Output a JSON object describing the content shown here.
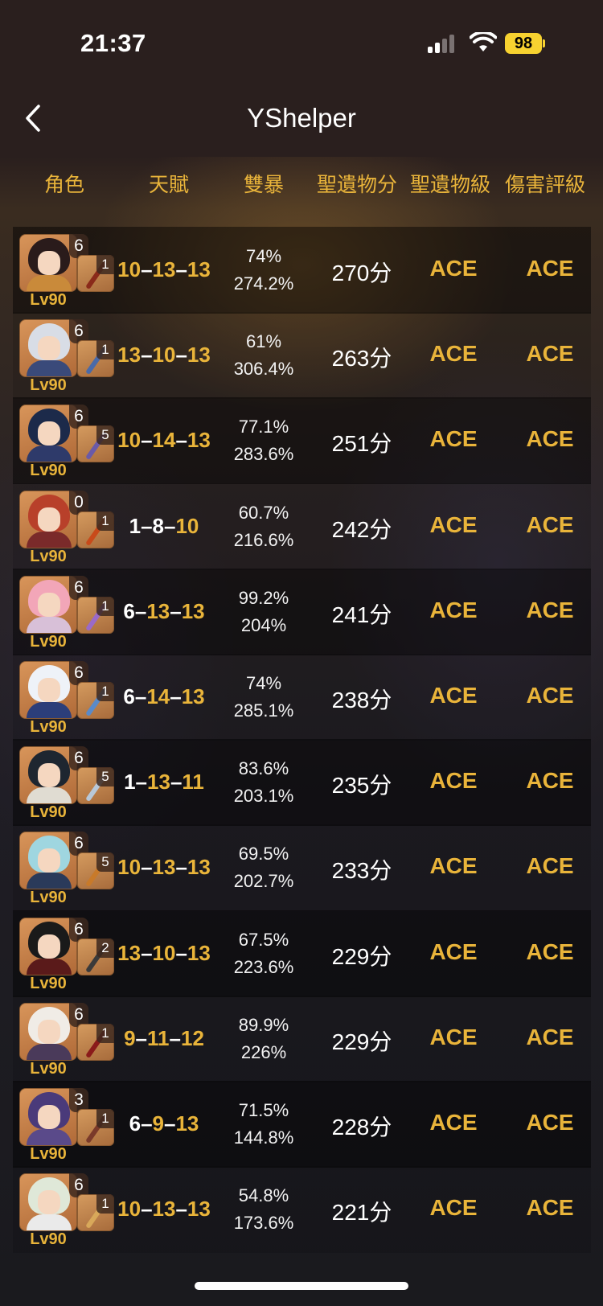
{
  "status_bar": {
    "time": "21:37",
    "battery": "98"
  },
  "nav": {
    "title": "YShelper"
  },
  "header": {
    "character": "角色",
    "talent": "天賦",
    "crit": "雙暴",
    "artifact_score": "聖遺物分",
    "artifact_grade": "聖遺物級",
    "damage_grade": "傷害評級"
  },
  "colors": {
    "accent": "#e9b43a",
    "text": "#ffffff",
    "header_bg": "#2a1f1e"
  },
  "rows": [
    {
      "constellation": "6",
      "refinement": "1",
      "level": "Lv90",
      "talent_1": "10",
      "talent_2": "13",
      "talent_3": "13",
      "crit_rate": "74%",
      "crit_dmg": "274.2%",
      "score": "270分",
      "artifact_grade": "ACE",
      "damage_grade": "ACE"
    },
    {
      "constellation": "6",
      "refinement": "1",
      "level": "Lv90",
      "talent_1": "13",
      "talent_2": "10",
      "talent_3": "13",
      "crit_rate": "61%",
      "crit_dmg": "306.4%",
      "score": "263分",
      "artifact_grade": "ACE",
      "damage_grade": "ACE"
    },
    {
      "constellation": "6",
      "refinement": "5",
      "level": "Lv90",
      "talent_1": "10",
      "talent_2": "14",
      "talent_3": "13",
      "crit_rate": "77.1%",
      "crit_dmg": "283.6%",
      "score": "251分",
      "artifact_grade": "ACE",
      "damage_grade": "ACE"
    },
    {
      "constellation": "0",
      "refinement": "1",
      "level": "Lv90",
      "talent_1": "1",
      "talent_2": "8",
      "talent_3": "10",
      "crit_rate": "60.7%",
      "crit_dmg": "216.6%",
      "score": "242分",
      "artifact_grade": "ACE",
      "damage_grade": "ACE"
    },
    {
      "constellation": "6",
      "refinement": "1",
      "level": "Lv90",
      "talent_1": "6",
      "talent_2": "13",
      "talent_3": "13",
      "crit_rate": "99.2%",
      "crit_dmg": "204%",
      "score": "241分",
      "artifact_grade": "ACE",
      "damage_grade": "ACE"
    },
    {
      "constellation": "6",
      "refinement": "1",
      "level": "Lv90",
      "talent_1": "6",
      "talent_2": "14",
      "talent_3": "13",
      "crit_rate": "74%",
      "crit_dmg": "285.1%",
      "score": "238分",
      "artifact_grade": "ACE",
      "damage_grade": "ACE"
    },
    {
      "constellation": "6",
      "refinement": "5",
      "level": "Lv90",
      "talent_1": "1",
      "talent_2": "13",
      "talent_3": "11",
      "crit_rate": "83.6%",
      "crit_dmg": "203.1%",
      "score": "235分",
      "artifact_grade": "ACE",
      "damage_grade": "ACE"
    },
    {
      "constellation": "6",
      "refinement": "5",
      "level": "Lv90",
      "talent_1": "10",
      "talent_2": "13",
      "talent_3": "13",
      "crit_rate": "69.5%",
      "crit_dmg": "202.7%",
      "score": "233分",
      "artifact_grade": "ACE",
      "damage_grade": "ACE"
    },
    {
      "constellation": "6",
      "refinement": "2",
      "level": "Lv90",
      "talent_1": "13",
      "talent_2": "10",
      "talent_3": "13",
      "crit_rate": "67.5%",
      "crit_dmg": "223.6%",
      "score": "229分",
      "artifact_grade": "ACE",
      "damage_grade": "ACE"
    },
    {
      "constellation": "6",
      "refinement": "1",
      "level": "Lv90",
      "talent_1": "9",
      "talent_2": "11",
      "talent_3": "12",
      "crit_rate": "89.9%",
      "crit_dmg": "226%",
      "score": "229分",
      "artifact_grade": "ACE",
      "damage_grade": "ACE"
    },
    {
      "constellation": "3",
      "refinement": "1",
      "level": "Lv90",
      "talent_1": "6",
      "talent_2": "9",
      "talent_3": "13",
      "crit_rate": "71.5%",
      "crit_dmg": "144.8%",
      "score": "228分",
      "artifact_grade": "ACE",
      "damage_grade": "ACE"
    },
    {
      "constellation": "6",
      "refinement": "1",
      "level": "Lv90",
      "talent_1": "10",
      "talent_2": "13",
      "talent_3": "13",
      "crit_rate": "54.8%",
      "crit_dmg": "173.6%",
      "score": "221分",
      "artifact_grade": "ACE",
      "damage_grade": "ACE"
    }
  ]
}
